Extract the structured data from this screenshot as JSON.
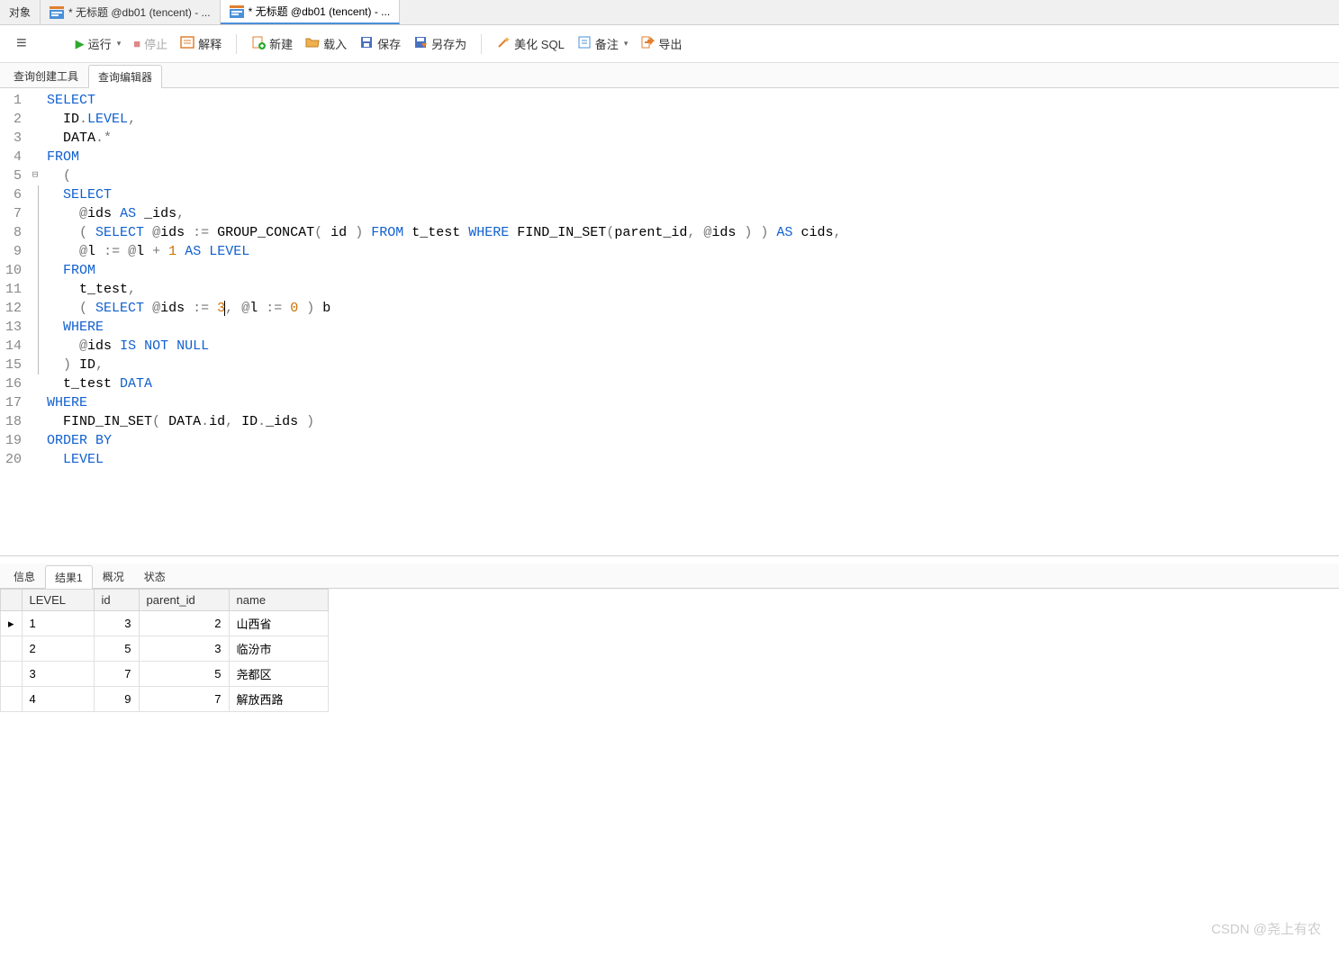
{
  "top_tabs": {
    "objects": "对象",
    "tab1": "* 无标题 @db01 (tencent) - ...",
    "tab2": "* 无标题 @db01 (tencent) - ..."
  },
  "toolbar": {
    "run": "运行",
    "stop": "停止",
    "explain": "解释",
    "new": "新建",
    "load": "载入",
    "save": "保存",
    "save_as": "另存为",
    "beautify": "美化 SQL",
    "notes": "备注",
    "export": "导出"
  },
  "sub_tabs": {
    "builder": "查询创建工具",
    "editor": "查询编辑器"
  },
  "code_lines": [
    [
      {
        "t": "SELECT",
        "c": "kw"
      }
    ],
    [
      {
        "t": "  ID",
        "c": ""
      },
      {
        "t": ".",
        "c": "op"
      },
      {
        "t": "LEVEL",
        "c": "kw"
      },
      {
        "t": ",",
        "c": "op"
      }
    ],
    [
      {
        "t": "  DATA",
        "c": ""
      },
      {
        "t": ".*",
        "c": "op"
      }
    ],
    [
      {
        "t": "FROM",
        "c": "kw"
      }
    ],
    [
      {
        "t": "  ",
        "c": ""
      },
      {
        "t": "(",
        "c": "op"
      }
    ],
    [
      {
        "t": "  ",
        "c": ""
      },
      {
        "t": "SELECT",
        "c": "kw"
      }
    ],
    [
      {
        "t": "    ",
        "c": ""
      },
      {
        "t": "@",
        "c": "op"
      },
      {
        "t": "ids ",
        "c": ""
      },
      {
        "t": "AS",
        "c": "kw"
      },
      {
        "t": " _ids",
        "c": ""
      },
      {
        "t": ",",
        "c": "op"
      }
    ],
    [
      {
        "t": "    ",
        "c": ""
      },
      {
        "t": "( ",
        "c": "op"
      },
      {
        "t": "SELECT",
        "c": "kw"
      },
      {
        "t": " ",
        "c": ""
      },
      {
        "t": "@",
        "c": "op"
      },
      {
        "t": "ids ",
        "c": ""
      },
      {
        "t": ":=",
        "c": "op"
      },
      {
        "t": " GROUP_CONCAT",
        "c": ""
      },
      {
        "t": "(",
        "c": "op"
      },
      {
        "t": " id ",
        "c": ""
      },
      {
        "t": ")",
        "c": "op"
      },
      {
        "t": " ",
        "c": ""
      },
      {
        "t": "FROM",
        "c": "kw"
      },
      {
        "t": " t_test ",
        "c": ""
      },
      {
        "t": "WHERE",
        "c": "kw"
      },
      {
        "t": " FIND_IN_SET",
        "c": ""
      },
      {
        "t": "(",
        "c": "op"
      },
      {
        "t": "parent_id",
        "c": ""
      },
      {
        "t": ",",
        "c": "op"
      },
      {
        "t": " ",
        "c": ""
      },
      {
        "t": "@",
        "c": "op"
      },
      {
        "t": "ids ",
        "c": ""
      },
      {
        "t": ") )",
        "c": "op"
      },
      {
        "t": " ",
        "c": ""
      },
      {
        "t": "AS",
        "c": "kw"
      },
      {
        "t": " cids",
        "c": ""
      },
      {
        "t": ",",
        "c": "op"
      }
    ],
    [
      {
        "t": "    ",
        "c": ""
      },
      {
        "t": "@",
        "c": "op"
      },
      {
        "t": "l ",
        "c": ""
      },
      {
        "t": ":=",
        "c": "op"
      },
      {
        "t": " ",
        "c": ""
      },
      {
        "t": "@",
        "c": "op"
      },
      {
        "t": "l ",
        "c": ""
      },
      {
        "t": "+",
        "c": "op"
      },
      {
        "t": " ",
        "c": ""
      },
      {
        "t": "1",
        "c": "num"
      },
      {
        "t": " ",
        "c": ""
      },
      {
        "t": "AS",
        "c": "kw"
      },
      {
        "t": " ",
        "c": ""
      },
      {
        "t": "LEVEL",
        "c": "kw"
      }
    ],
    [
      {
        "t": "  ",
        "c": ""
      },
      {
        "t": "FROM",
        "c": "kw"
      }
    ],
    [
      {
        "t": "    t_test",
        "c": ""
      },
      {
        "t": ",",
        "c": "op"
      }
    ],
    [
      {
        "t": "    ",
        "c": ""
      },
      {
        "t": "( ",
        "c": "op"
      },
      {
        "t": "SELECT",
        "c": "kw"
      },
      {
        "t": " ",
        "c": ""
      },
      {
        "t": "@",
        "c": "op"
      },
      {
        "t": "ids ",
        "c": ""
      },
      {
        "t": ":=",
        "c": "op"
      },
      {
        "t": " ",
        "c": ""
      },
      {
        "t": "3",
        "c": "num"
      },
      {
        "t": "",
        "c": "cursor"
      },
      {
        "t": ",",
        "c": "op"
      },
      {
        "t": " ",
        "c": ""
      },
      {
        "t": "@",
        "c": "op"
      },
      {
        "t": "l ",
        "c": ""
      },
      {
        "t": ":=",
        "c": "op"
      },
      {
        "t": " ",
        "c": ""
      },
      {
        "t": "0",
        "c": "num"
      },
      {
        "t": " ",
        "c": ""
      },
      {
        "t": ")",
        "c": "op"
      },
      {
        "t": " b",
        "c": ""
      }
    ],
    [
      {
        "t": "  ",
        "c": ""
      },
      {
        "t": "WHERE",
        "c": "kw"
      }
    ],
    [
      {
        "t": "    ",
        "c": ""
      },
      {
        "t": "@",
        "c": "op"
      },
      {
        "t": "ids ",
        "c": ""
      },
      {
        "t": "IS NOT NULL",
        "c": "kw"
      }
    ],
    [
      {
        "t": "  ",
        "c": ""
      },
      {
        "t": ")",
        "c": "op"
      },
      {
        "t": " ID",
        "c": ""
      },
      {
        "t": ",",
        "c": "op"
      }
    ],
    [
      {
        "t": "  t_test ",
        "c": ""
      },
      {
        "t": "DATA",
        "c": "kw"
      }
    ],
    [
      {
        "t": "WHERE",
        "c": "kw"
      }
    ],
    [
      {
        "t": "  FIND_IN_SET",
        "c": ""
      },
      {
        "t": "(",
        "c": "op"
      },
      {
        "t": " DATA",
        "c": ""
      },
      {
        "t": ".",
        "c": "op"
      },
      {
        "t": "id",
        "c": ""
      },
      {
        "t": ",",
        "c": "op"
      },
      {
        "t": " ID",
        "c": ""
      },
      {
        "t": ".",
        "c": "op"
      },
      {
        "t": "_ids ",
        "c": ""
      },
      {
        "t": ")",
        "c": "op"
      }
    ],
    [
      {
        "t": "ORDER BY",
        "c": "kw"
      }
    ],
    [
      {
        "t": "  ",
        "c": ""
      },
      {
        "t": "LEVEL",
        "c": "kw"
      }
    ]
  ],
  "fold_marker_line": 5,
  "fold_end_line": 15,
  "result_tabs": {
    "info": "信息",
    "result1": "结果1",
    "profile": "概况",
    "status": "状态"
  },
  "result_grid": {
    "columns": [
      "LEVEL",
      "id",
      "parent_id",
      "name"
    ],
    "rows": [
      {
        "LEVEL": "1",
        "id": "3",
        "parent_id": "2",
        "name": "山西省",
        "current": true
      },
      {
        "LEVEL": "2",
        "id": "5",
        "parent_id": "3",
        "name": "临汾市",
        "current": false
      },
      {
        "LEVEL": "3",
        "id": "7",
        "parent_id": "5",
        "name": "尧都区",
        "current": false
      },
      {
        "LEVEL": "4",
        "id": "9",
        "parent_id": "7",
        "name": "解放西路",
        "current": false
      }
    ]
  },
  "watermark": "CSDN @尧上有农"
}
